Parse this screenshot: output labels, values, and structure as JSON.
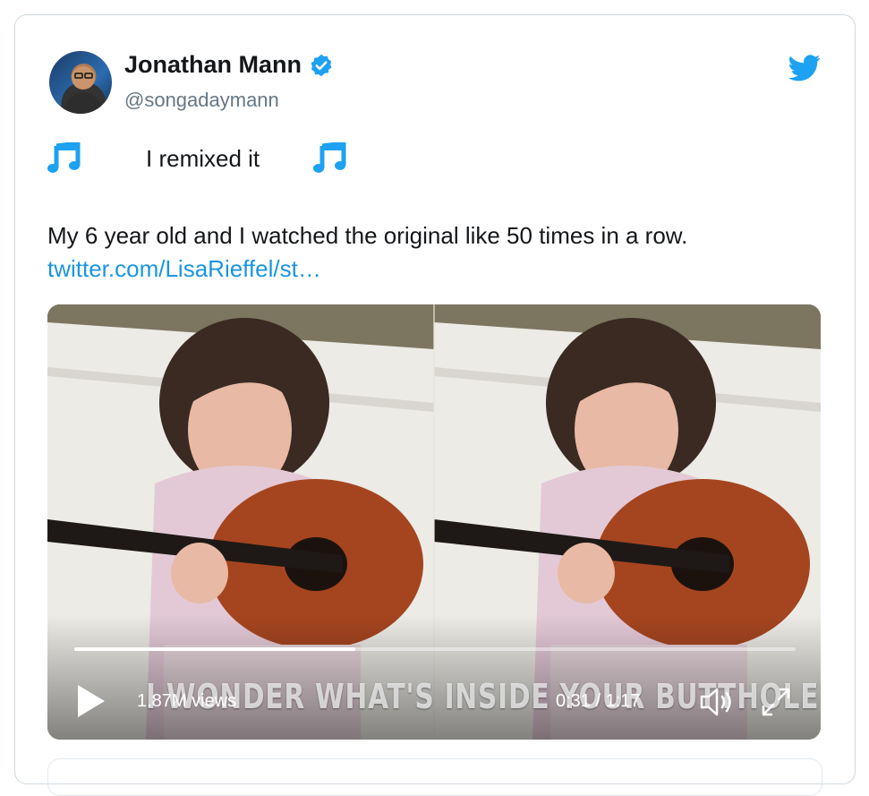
{
  "tweet": {
    "author_name": "Jonathan Mann",
    "author_handle": "@songadaymann",
    "line1": "I remixed it",
    "body": "My 6 year old and I watched the original like 50 times in a row.",
    "link": "twitter.com/LisaRieffel/st…"
  },
  "video": {
    "caption": "I WONDER WHAT'S INSIDE YOUR BUTTHOLE?",
    "views": "1.87M views",
    "time": "0:31 / 1:17",
    "progress": 0.39
  },
  "icons": {
    "verified": "verified-badge-icon",
    "bird": "twitter-bird-icon",
    "note": "music-note-icon",
    "play": "play-icon",
    "volume": "volume-icon",
    "fullscreen": "fullscreen-icon"
  },
  "colors": {
    "accent": "#1da1f2",
    "link": "#1b95e0",
    "handle": "#657786"
  }
}
